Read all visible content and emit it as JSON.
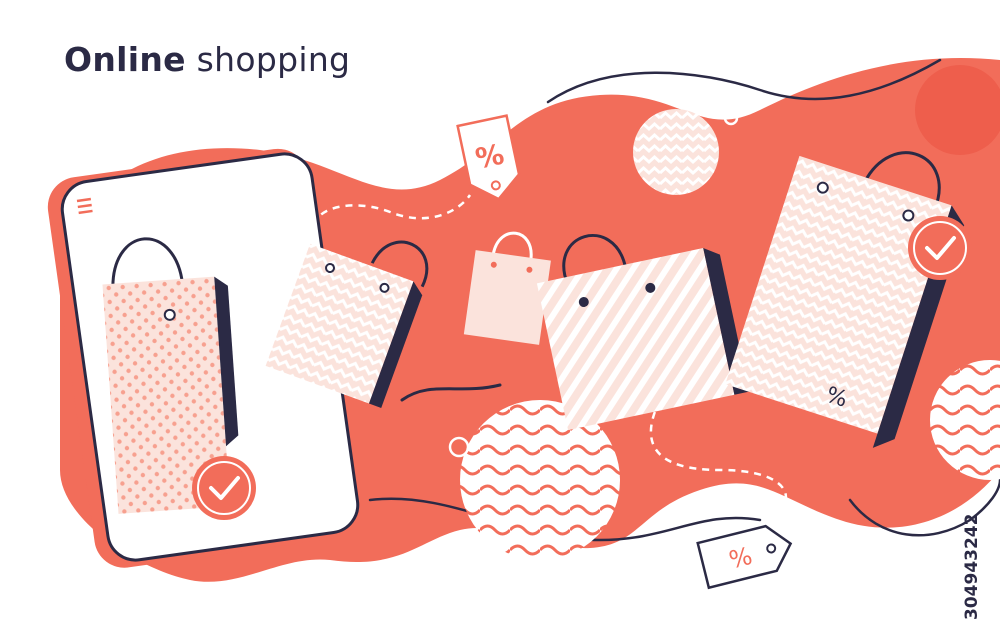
{
  "headline": {
    "bold_word": "Online",
    "light_word": "shopping"
  },
  "watermark": {
    "stock_id": "304943242"
  },
  "badges": {
    "percent_symbol": "%"
  },
  "colors": {
    "coral": "#f26d5a",
    "coral_light": "#f7a08f",
    "blush": "#fbe3dc",
    "navy": "#2b2a45",
    "white": "#ffffff"
  }
}
